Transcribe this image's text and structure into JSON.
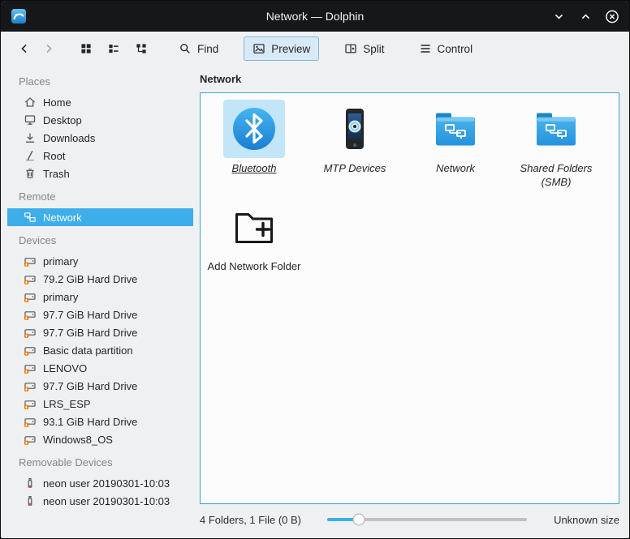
{
  "window": {
    "title": "Network — Dolphin"
  },
  "toolbar": {
    "buttons": [
      {
        "label": "Find",
        "icon": "magnifier-icon"
      },
      {
        "label": "Preview",
        "icon": "preview-icon",
        "active": true
      },
      {
        "label": "Split",
        "icon": "split-icon"
      },
      {
        "label": "Control",
        "icon": "menu-icon"
      }
    ]
  },
  "sidebar": {
    "sections": [
      {
        "label": "Places",
        "items": [
          {
            "label": "Home",
            "icon": "home-icon"
          },
          {
            "label": "Desktop",
            "icon": "desktop-icon"
          },
          {
            "label": "Downloads",
            "icon": "download-icon"
          },
          {
            "label": "Root",
            "icon": "root-icon"
          },
          {
            "label": "Trash",
            "icon": "trash-icon"
          }
        ]
      },
      {
        "label": "Remote",
        "items": [
          {
            "label": "Network",
            "icon": "network-places-icon",
            "selected": true
          }
        ]
      },
      {
        "label": "Devices",
        "items": [
          {
            "label": "primary",
            "icon": "drive-icon"
          },
          {
            "label": "79.2 GiB Hard Drive",
            "icon": "drive-icon"
          },
          {
            "label": "primary",
            "icon": "drive-icon"
          },
          {
            "label": "97.7 GiB Hard Drive",
            "icon": "drive-icon"
          },
          {
            "label": "97.7 GiB Hard Drive",
            "icon": "drive-icon"
          },
          {
            "label": "Basic data partition",
            "icon": "drive-icon"
          },
          {
            "label": "LENOVO",
            "icon": "drive-icon"
          },
          {
            "label": "97.7 GiB Hard Drive",
            "icon": "drive-icon"
          },
          {
            "label": "LRS_ESP",
            "icon": "drive-icon"
          },
          {
            "label": "93.1 GiB Hard Drive",
            "icon": "drive-icon"
          },
          {
            "label": "Windows8_OS",
            "icon": "drive-icon"
          }
        ]
      },
      {
        "label": "Removable Devices",
        "items": [
          {
            "label": "neon user 20190301-10:03",
            "icon": "usb-icon"
          },
          {
            "label": "neon user 20190301-10:03",
            "icon": "usb-icon"
          }
        ]
      }
    ]
  },
  "main": {
    "location_label": "Network",
    "items": [
      {
        "label": "Bluetooth",
        "icon": "bluetooth-icon",
        "selected": true
      },
      {
        "label": "MTP Devices",
        "icon": "mtp-devices-icon"
      },
      {
        "label": "Network",
        "icon": "folder-network-icon"
      },
      {
        "label": "Shared Folders (SMB)",
        "icon": "folder-share-icon"
      },
      {
        "label": "Add Network Folder",
        "icon": "folder-add-icon"
      }
    ]
  },
  "statusbar": {
    "summary": "4 Folders, 1 File (0 B)",
    "size": "Unknown size",
    "zoom_percent": 16
  },
  "colors": {
    "accent": "#3daee9",
    "titlebar_bg": "#151719",
    "window_bg": "#eff0f1",
    "view_bg": "#fcfcfc",
    "selection_text": "#fcfcfc"
  }
}
